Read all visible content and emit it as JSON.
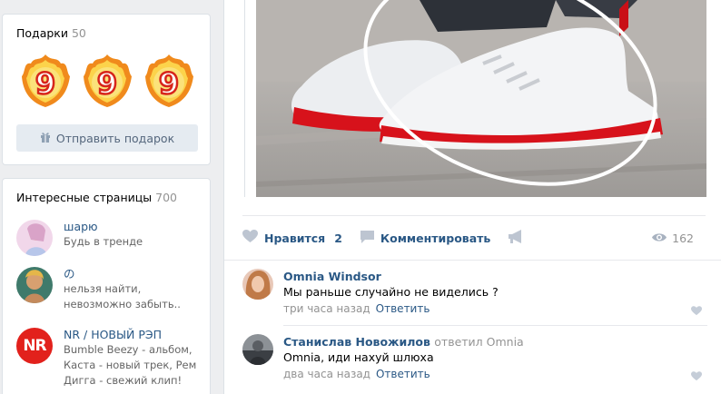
{
  "gifts": {
    "title": "Подарки",
    "count": "50",
    "items": [
      {
        "label": "9"
      },
      {
        "label": "9"
      },
      {
        "label": "9"
      }
    ],
    "send_button": "Отправить подарок"
  },
  "pages": {
    "title": "Интересные страницы",
    "count": "700",
    "items": [
      {
        "name": "шарю",
        "desc": [
          "Будь в тренде"
        ]
      },
      {
        "name": "の",
        "desc": [
          "нельзя найти,",
          "невозможно забыть.."
        ]
      },
      {
        "name": "NR / НОВЫЙ РЭП",
        "desc": [
          "Bumble Beezy - альбом,",
          "Каста - новый трек, Рем",
          "Дигга - свежий клип!"
        ],
        "logo": "NR"
      }
    ]
  },
  "post": {
    "like_label": "Нравится",
    "like_count": "2",
    "comment_label": "Комментировать",
    "views": "162"
  },
  "comments": [
    {
      "author": "Omnia Windsor",
      "replied": "",
      "text": "Мы раньше случайно не виделись ?",
      "time": "три часа назад",
      "reply": "Ответить"
    },
    {
      "author": "Станислав Новожилов",
      "replied": "ответил Omnia",
      "text": "Omnia, иди нахуй шлюха",
      "time": "два часа назад",
      "reply": "Ответить"
    }
  ],
  "colors": {
    "link": "#2a5885",
    "muted": "#939393",
    "accent": "#e2211c"
  }
}
